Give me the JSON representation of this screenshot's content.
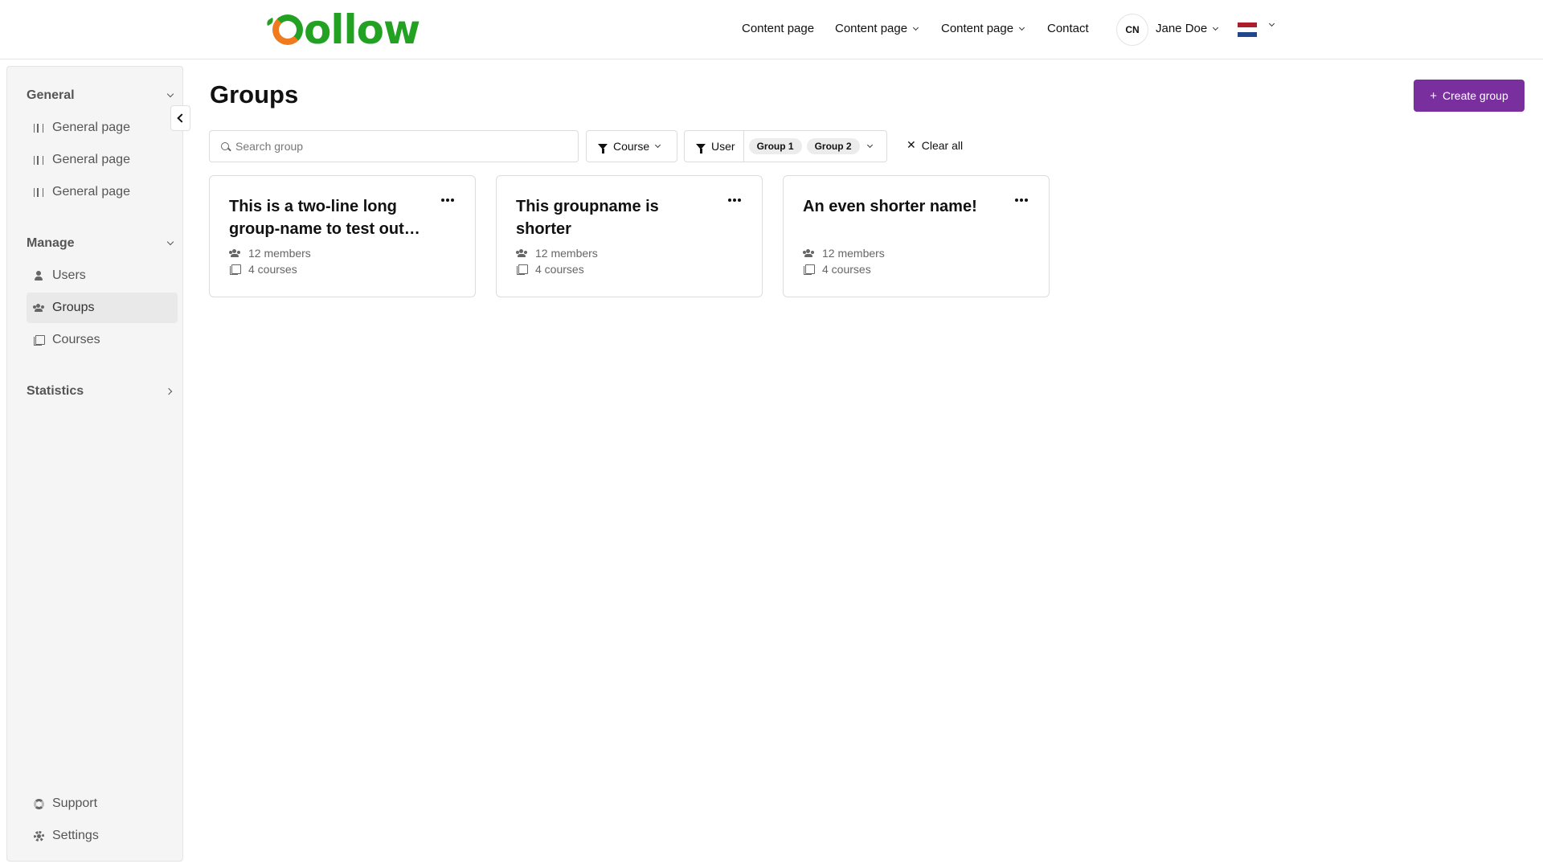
{
  "header": {
    "logo_text": "ollow",
    "nav": [
      {
        "label": "Content page",
        "dropdown": false
      },
      {
        "label": "Content page",
        "dropdown": true
      },
      {
        "label": "Content page",
        "dropdown": true
      },
      {
        "label": "Contact",
        "dropdown": false
      }
    ],
    "user": {
      "initials": "CN",
      "name": "Jane Doe"
    },
    "language_flag": "nl-flag-icon"
  },
  "sidebar": {
    "sections": [
      {
        "title": "General",
        "expanded": true,
        "items": [
          {
            "label": "General page",
            "icon": "map-icon"
          },
          {
            "label": "General page",
            "icon": "map-icon"
          },
          {
            "label": "General page",
            "icon": "map-icon"
          }
        ]
      },
      {
        "title": "Manage",
        "expanded": true,
        "items": [
          {
            "label": "Users",
            "icon": "user-icon"
          },
          {
            "label": "Groups",
            "icon": "group-icon",
            "active": true
          },
          {
            "label": "Courses",
            "icon": "book-icon"
          }
        ]
      },
      {
        "title": "Statistics",
        "expanded": false,
        "items": []
      }
    ],
    "footer": [
      {
        "label": "Support",
        "icon": "support-icon"
      },
      {
        "label": "Settings",
        "icon": "gear-icon"
      }
    ]
  },
  "main": {
    "title": "Groups",
    "create_button": {
      "icon": "+",
      "label": "Create group"
    },
    "search": {
      "placeholder": "Search group",
      "value": ""
    },
    "filters": {
      "course": {
        "label": "Course"
      },
      "user": {
        "label": "User",
        "chips": [
          "Group 1",
          "Group 2"
        ]
      },
      "clear_all": "Clear all"
    },
    "cards": [
      {
        "title": "This is a two-line long group-name to test out…",
        "members": "12 members",
        "courses": "4 courses"
      },
      {
        "title": "This groupname is shorter",
        "members": "12 members",
        "courses": "4 courses"
      },
      {
        "title": "An even shorter name!",
        "members": "12 members",
        "courses": "4 courses"
      }
    ]
  },
  "colors": {
    "brand_green": "#22a122",
    "brand_orange": "#f07a1e",
    "primary_purple": "#7a2f9e",
    "sidebar_bg": "#f5f5f5"
  }
}
